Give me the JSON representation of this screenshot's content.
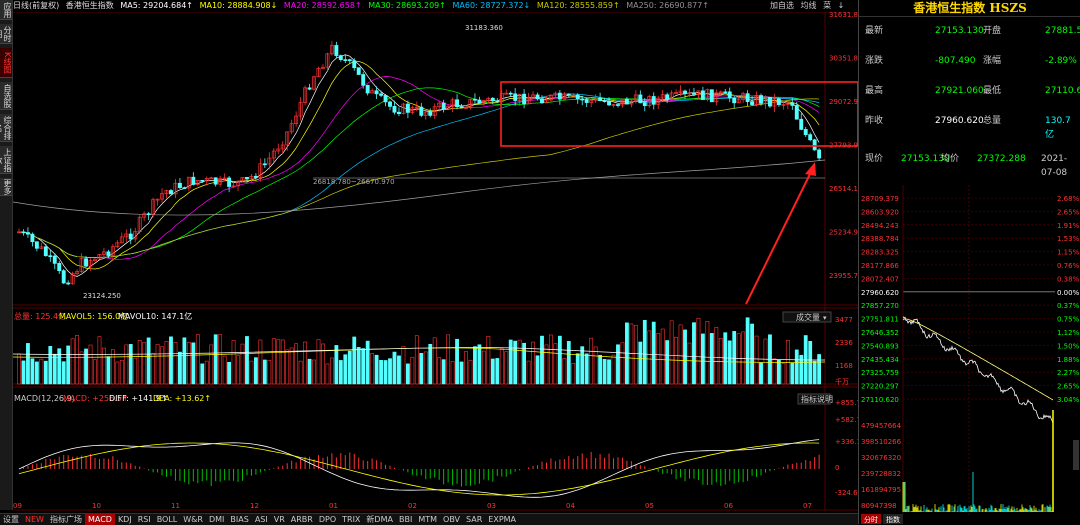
{
  "left_tabs": [
    {
      "label": "应用",
      "active": false
    },
    {
      "label": "分时图",
      "active": false
    },
    {
      "label": "K线图",
      "active": true
    },
    {
      "label": "自选股",
      "active": false
    },
    {
      "label": "综合排名",
      "active": false
    },
    {
      "label": "上证指数",
      "active": false
    },
    {
      "label": "更多",
      "active": false
    }
  ],
  "ma_bar": {
    "period": "日线(前复权)",
    "name": "香港恒生指数",
    "ma5": "MA5: 29204.684↑",
    "ma10": "MA10: 28884.908↓",
    "ma20": "MA20: 28592.658↑",
    "ma30": "MA30: 28693.209↑",
    "ma60": "MA60: 28727.372↓",
    "ma120": "MA120: 28555.859↑",
    "ma250": "MA250: 26690.877↑"
  },
  "top_right": {
    "add_watch": "加自选",
    "mean_line": "均线",
    "menu_icon": "菜",
    "arrow_icon": "↓"
  },
  "main_chart": {
    "price_labels": [
      "31631.86",
      "30351.88",
      "29072.95",
      "27793.91",
      "26514.19",
      "25234.96",
      "23955.74"
    ],
    "high_label": "31183.360",
    "low_label": "23124.250",
    "mid_label": "26818.780~26670.970"
  },
  "volume_panel": {
    "total": "总量: 125.4亿",
    "mavol5": "MAVOL5: 156.0亿",
    "mavol10": "MAVOL10: 147.1亿",
    "dropdown": "成交量",
    "labels": [
      "3477",
      "2336",
      "1168",
      "千万"
    ]
  },
  "macd_panel": {
    "title": "MACD(12,26,9)",
    "macd": "MACD: +256.5↑",
    "diff": "DIFF: +141.9↑",
    "dea": "DEA: +13.62↑",
    "help": "指标说明",
    "labels": [
      "+855.7",
      "+582.7",
      "+336.1",
      "0",
      "-324.6"
    ]
  },
  "x_axis": [
    "09",
    "10",
    "11",
    "12",
    "01",
    "02",
    "03",
    "04",
    "05",
    "06",
    "07"
  ],
  "bottom_tabs": [
    {
      "label": "设置",
      "style": "normal"
    },
    {
      "label": "NEW",
      "style": "red"
    },
    {
      "label": "指标广场",
      "style": "normal"
    },
    {
      "label": "MACD",
      "style": "active"
    },
    {
      "label": "KDJ",
      "style": "normal"
    },
    {
      "label": "RSI",
      "style": "normal"
    },
    {
      "label": "BOLL",
      "style": "normal"
    },
    {
      "label": "W&R",
      "style": "normal"
    },
    {
      "label": "DMI",
      "style": "normal"
    },
    {
      "label": "BIAS",
      "style": "normal"
    },
    {
      "label": "ASI",
      "style": "normal"
    },
    {
      "label": "VR",
      "style": "normal"
    },
    {
      "label": "ARBR",
      "style": "normal"
    },
    {
      "label": "DPO",
      "style": "normal"
    },
    {
      "label": "TRIX",
      "style": "normal"
    },
    {
      "label": "新DMA",
      "style": "normal"
    },
    {
      "label": "BBI",
      "style": "normal"
    },
    {
      "label": "MTM",
      "style": "normal"
    },
    {
      "label": "OBV",
      "style": "normal"
    },
    {
      "label": "SAR",
      "style": "normal"
    },
    {
      "label": "EXPMA",
      "style": "normal"
    }
  ],
  "right_panel": {
    "title": "香港恒生指数 HSZS",
    "quote": [
      {
        "l1": "最新",
        "v1": "27153.130",
        "l2": "开盘",
        "v2": "27881.500"
      },
      {
        "l1": "涨跌",
        "v1": "-807.490",
        "l2": "涨幅",
        "v2": "-2.89%"
      },
      {
        "l1": "最高",
        "v1": "27921.060",
        "l2": "最低",
        "v2": "27110.620"
      },
      {
        "l1": "昨收",
        "v1": "27960.620",
        "l2": "总量",
        "v2": "130.7亿"
      }
    ],
    "timeline_header": {
      "now_label": "现价",
      "now_value": "27153.130",
      "avg_label": "均价",
      "avg_value": "27372.288",
      "date": "2021-07-08"
    },
    "timeline_prices": [
      "28709.379",
      "28603.920",
      "28494.243",
      "28388.784",
      "28283.325",
      "28177.866",
      "28072.407",
      "27960.620",
      "27857.270",
      "27751.811",
      "27646.352",
      "27540.893",
      "27435.434",
      "27325.759",
      "27220.297",
      "27110.620"
    ],
    "timeline_pcts": [
      "2.68%",
      "2.65%",
      "1.91%",
      "1.53%",
      "1.15%",
      "0.76%",
      "0.38%",
      "0.00%",
      "0.37%",
      "0.75%",
      "1.12%",
      "1.50%",
      "1.88%",
      "2.27%",
      "2.65%",
      "3.04%"
    ],
    "volume_labels": [
      "479457664",
      "398510266",
      "320676320",
      "239728832",
      "161894795",
      "80947398"
    ],
    "tabs": [
      "分时",
      "指数"
    ]
  },
  "colors": {
    "up": "#ff3232",
    "down": "#54ffff",
    "ma5": "#ffffff",
    "ma10": "#ffff00",
    "ma20": "#ff00ff",
    "ma30": "#00ff00",
    "ma60": "#00c0ff",
    "ma120": "#c8c800",
    "ma250": "#a0a0a0",
    "highlight": "#ff2020"
  }
}
